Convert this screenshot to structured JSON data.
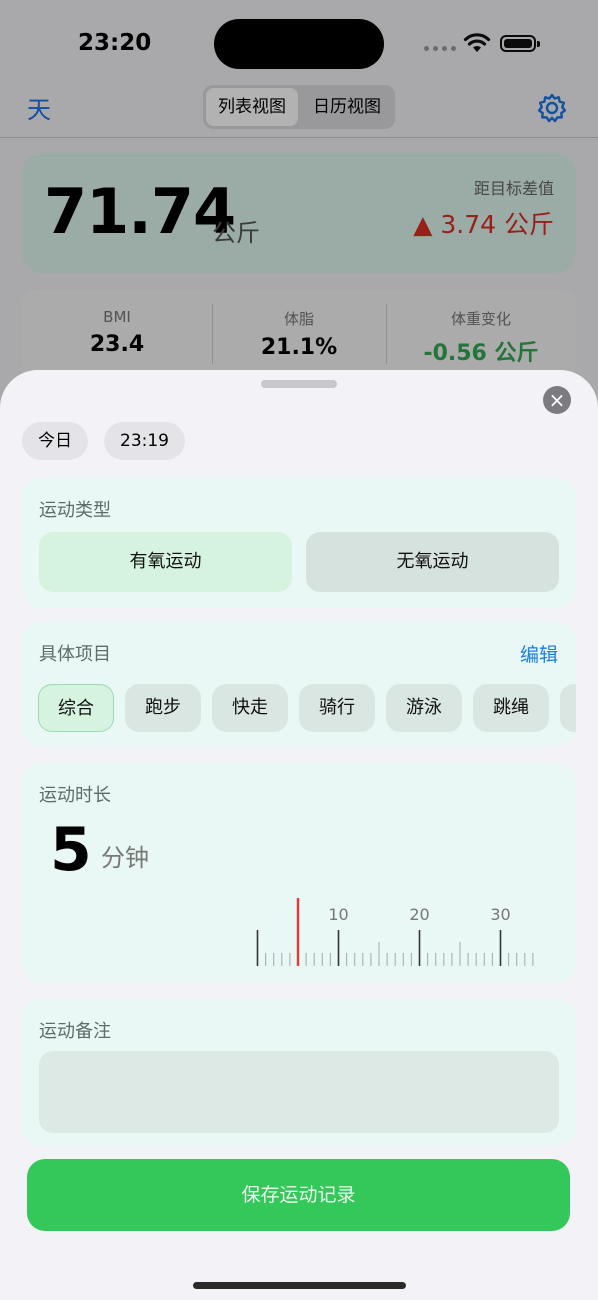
{
  "status": {
    "time": "23:20"
  },
  "nav": {
    "left": "天",
    "segments": [
      "列表视图",
      "日历视图"
    ],
    "settings_icon": "gear-icon"
  },
  "weight_card": {
    "value": "71.74",
    "unit": "公斤",
    "diff_label": "距目标差值",
    "diff_value": "▲ 3.74 公斤",
    "diff_color": "#d93025"
  },
  "stats": [
    {
      "label": "BMI",
      "value": "23.4"
    },
    {
      "label": "体脂",
      "value": "21.1%"
    },
    {
      "label": "体重变化",
      "value": "-0.56 公斤",
      "color": "#34a853"
    }
  ],
  "sheet": {
    "close_icon": "close-icon",
    "date_chip": "今日",
    "time_chip": "23:19",
    "exercise_type": {
      "title": "运动类型",
      "options": [
        "有氧运动",
        "无氧运动"
      ],
      "selected": "有氧运动"
    },
    "items": {
      "title": "具体项目",
      "edit": "编辑",
      "tags": [
        "综合",
        "跑步",
        "快走",
        "骑行",
        "游泳",
        "跳绳"
      ],
      "selected": "综合"
    },
    "duration": {
      "title": "运动时长",
      "value": "5",
      "unit": "分钟",
      "ruler_labels": [
        "10",
        "20",
        "30"
      ]
    },
    "note": {
      "title": "运动备注",
      "placeholder": ""
    },
    "save_button": "保存运动记录"
  },
  "colors": {
    "accent_green": "#34c759",
    "link_blue": "#1a7fe0"
  }
}
